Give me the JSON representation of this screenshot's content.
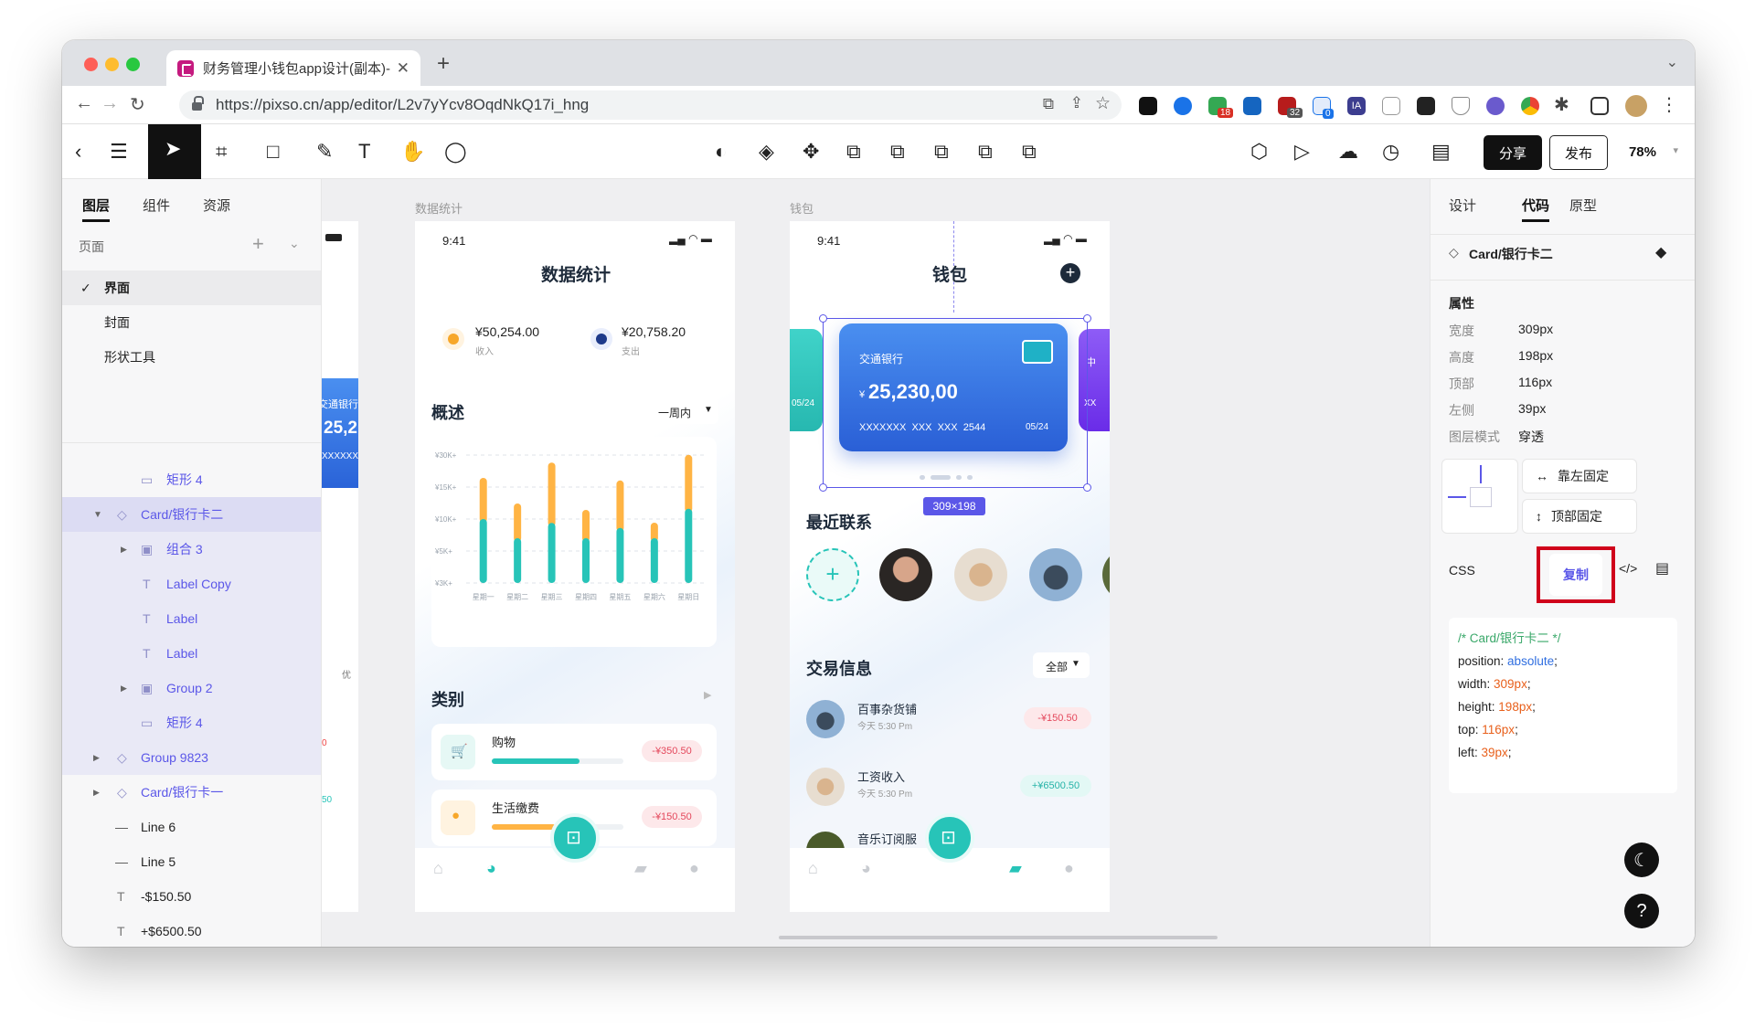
{
  "browser": {
    "tab_title": "财务管理小钱包app设计(副本)-P",
    "url": "https://pixso.cn/app/editor/L2v7yYcv8OqdNkQ17i_hng",
    "ext_badges": [
      "18",
      "32",
      "0"
    ]
  },
  "toolbar": {
    "share_label": "分享",
    "publish_label": "发布",
    "zoom": "78%"
  },
  "left_panel": {
    "tabs": [
      "图层",
      "组件",
      "资源"
    ],
    "pages_label": "页面",
    "pages": [
      "界面",
      "封面",
      "形状工具"
    ],
    "layers": [
      "矩形 4",
      "Card/银行卡二",
      "组合 3",
      "Label Copy",
      "Label",
      "Label",
      "Group 2",
      "矩形 4",
      "Group 9823",
      "Card/银行卡一",
      "Line 6",
      "Line 5",
      "-$150.50",
      "+$6500.50"
    ]
  },
  "canvas": {
    "frame1_label": "数据统计",
    "frame2_label": "钱包",
    "selection_size": "309×198",
    "left_partial": {
      "bank": "交通银行",
      "amount": "25,2",
      "num": "XXXXXX",
      "tag": "优",
      "v1": "0",
      "v2": "50"
    },
    "stats": {
      "time": "9:41",
      "title": "数据统计",
      "income": "¥50,254.00",
      "income_label": "收入",
      "expense": "¥20,758.20",
      "expense_label": "支出",
      "overview": "概述",
      "period": "一周内",
      "category": "类别",
      "cat1_name": "购物",
      "cat1_amount": "-¥350.50",
      "cat2_name": "生活缴费",
      "cat2_amount": "-¥150.50"
    },
    "wallet": {
      "time": "9:41",
      "title": "钱包",
      "card_bank": "交通银行",
      "card_amount": "25,230,00",
      "card_currency": "¥",
      "card_number": "XXXXXXX  XXX  XXX  2544",
      "card_exp": "05/24",
      "side_exp": "05/24",
      "side_prefix": "XX",
      "side_bank": "中",
      "recent": "最近联系",
      "transactions": "交易信息",
      "filter": "全部",
      "tx1_name": "百事杂货铺",
      "tx1_time": "今天 5:30 Pm",
      "tx1_amount": "-¥150.50",
      "tx2_name": "工资收入",
      "tx2_time": "今天 5:30 Pm",
      "tx2_amount": "+¥6500.50",
      "tx3_name": "音乐订阅服",
      "tx3_time": "Pm"
    }
  },
  "chart_data": {
    "type": "bar",
    "categories": [
      "星期一",
      "星期二",
      "星期三",
      "星期四",
      "星期五",
      "星期六",
      "星期日"
    ],
    "y_ticks": [
      "¥30K+",
      "¥15K+",
      "¥10K+",
      "¥5K+",
      "¥3K+"
    ],
    "series": [
      {
        "values": [
          0.5,
          0.35,
          0.47,
          0.35,
          0.43,
          0.35,
          0.58
        ]
      },
      {
        "values": [
          0.35,
          0.3,
          0.5,
          0.25,
          0.4,
          0.15,
          0.45
        ]
      }
    ],
    "note_units": "relative fraction of chart height (bottom segment, top segment)"
  },
  "right_panel": {
    "tabs": [
      "设计",
      "代码",
      "原型"
    ],
    "component": "Card/银行卡二",
    "props_label": "属性",
    "props": [
      {
        "k": "宽度",
        "v": "309px"
      },
      {
        "k": "高度",
        "v": "198px"
      },
      {
        "k": "顶部",
        "v": "116px"
      },
      {
        "k": "左侧",
        "v": "39px"
      },
      {
        "k": "图层模式",
        "v": "穿透"
      }
    ],
    "pin_left": "靠左固定",
    "pin_top": "顶部固定",
    "css_label": "CSS",
    "copy_label": "复制",
    "code": {
      "comment": "/* Card/银行卡二 */",
      "l1k": "position: ",
      "l1v": "absolute",
      "l2k": "width: ",
      "l2v": "309px",
      "l3k": "height: ",
      "l3v": "198px",
      "l4k": "top: ",
      "l4v": "116px",
      "l5k": "left: ",
      "l5v": "39px"
    },
    "help": "?"
  },
  "colors": {
    "accent": "#5b57e8",
    "teal": "#27c4b8",
    "orange": "#ffb444",
    "card_blue": "#2f6ee0",
    "red_box": "#d0021b"
  }
}
